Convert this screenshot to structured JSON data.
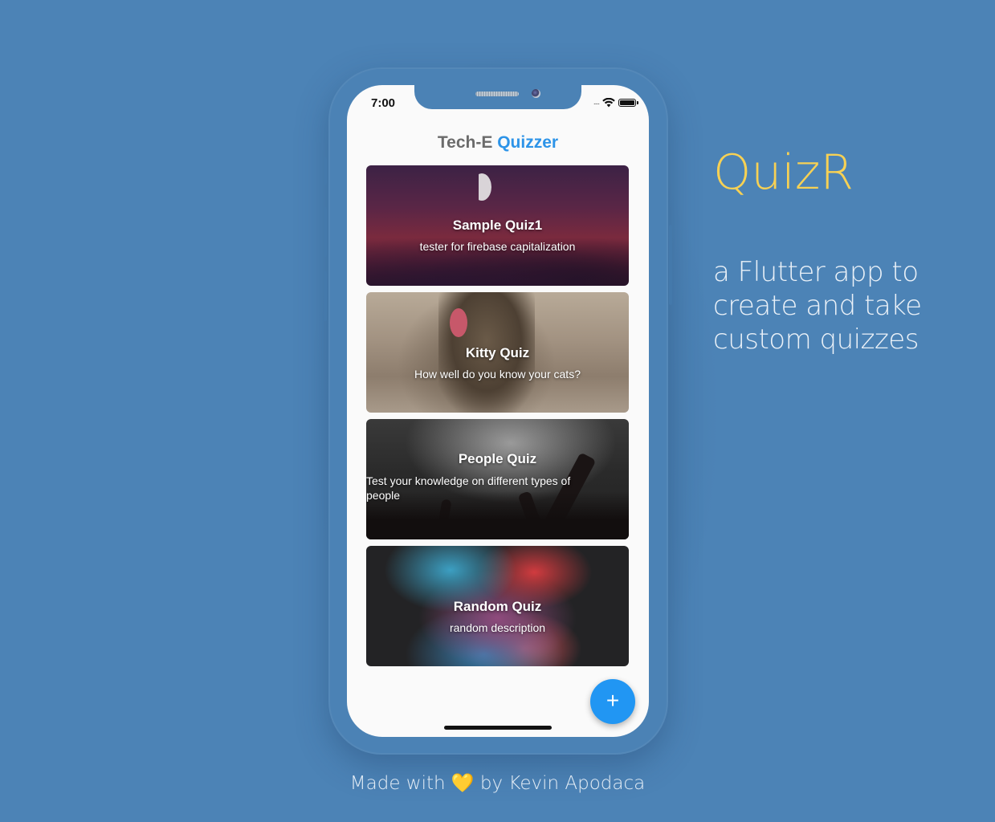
{
  "status_bar": {
    "time": "7:00",
    "signal_icon": "signal-dots-icon",
    "wifi_icon": "wifi-icon",
    "battery_icon": "battery-icon"
  },
  "app_bar": {
    "title_part1": "Tech-E",
    "title_part2": "Quizzer"
  },
  "quizzes": [
    {
      "title": "Sample Quiz1",
      "description": "tester for firebase capitalization"
    },
    {
      "title": "Kitty Quiz",
      "description": "How well do you know your cats?"
    },
    {
      "title": "People Quiz",
      "description": "Test your knowledge on different types of people"
    },
    {
      "title": "Random Quiz",
      "description": "random description"
    }
  ],
  "fab": {
    "label": "+",
    "icon": "plus-icon"
  },
  "promo": {
    "name": "QuizR",
    "tagline": "a Flutter app to create and take custom quizzes"
  },
  "footer": {
    "made_with": "Made with",
    "heart": "💛",
    "by": "by Kevin Apodaca"
  },
  "colors": {
    "background": "#4c83b6",
    "accent_blue": "#2196f3",
    "title_gray": "#6b6b6b",
    "brand_yellow": "#f7d154"
  }
}
